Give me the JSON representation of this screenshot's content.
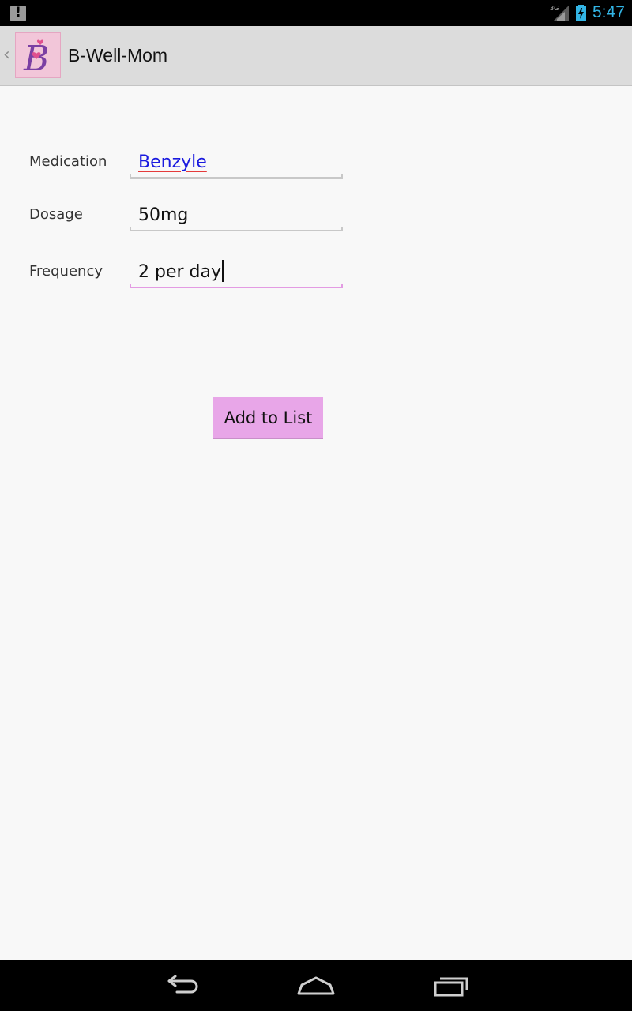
{
  "status_bar": {
    "time": "5:47",
    "network_type": "3G",
    "clock_color": "#33b5e5",
    "icons": [
      "notification-alert-icon",
      "signal-icon",
      "battery-charging-icon"
    ]
  },
  "action_bar": {
    "up_glyph": "‹",
    "title": "B-Well-Mom",
    "logo_letter": "B"
  },
  "form": {
    "medication": {
      "label": "Medication",
      "value": "Benzyle"
    },
    "dosage": {
      "label": "Dosage",
      "value": "50mg"
    },
    "frequency": {
      "label": "Frequency",
      "value": "2 per day"
    },
    "focused_field": "frequency",
    "accent_color": "#e8a6e8"
  },
  "add_button": {
    "label": "Add to List"
  },
  "nav_bar": {
    "icons": [
      "back-icon",
      "home-icon",
      "recent-apps-icon"
    ]
  }
}
